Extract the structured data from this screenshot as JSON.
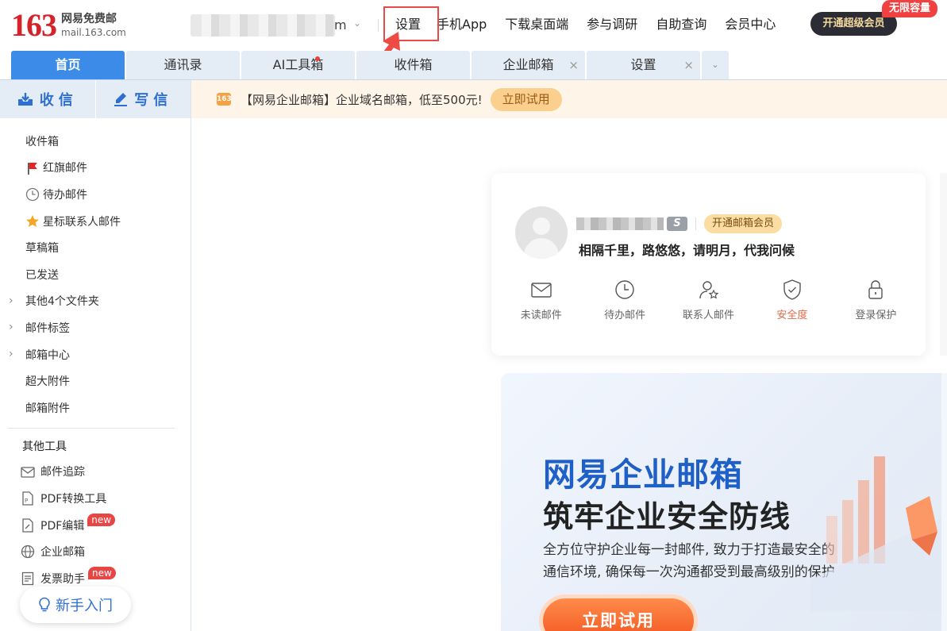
{
  "brand": {
    "number": "163",
    "name_cn": "网易免费邮",
    "domain": "mail.163.com"
  },
  "user": {
    "account_suffix": "m"
  },
  "top_nav": {
    "settings": "设置",
    "mobile_app": "手机App",
    "desktop": "下载桌面端",
    "survey": "参与调研",
    "self_service": "自助查询",
    "member_center": "会员中心",
    "super_vip": "开通超级会员",
    "vip_badge": "无限容量"
  },
  "tabs": [
    {
      "label": "首页"
    },
    {
      "label": "通讯录"
    },
    {
      "label": "AI工具箱"
    },
    {
      "label": "收件箱"
    },
    {
      "label": "企业邮箱"
    },
    {
      "label": "设置"
    }
  ],
  "tab_close": "×",
  "sidebar": {
    "receive": "收信",
    "compose": "写信",
    "folders": [
      "收件箱",
      "红旗邮件",
      "待办邮件",
      "星标联系人邮件",
      "草稿箱",
      "已发送",
      "其他4个文件夹",
      "邮件标签",
      "邮箱中心",
      "超大附件",
      "邮箱附件"
    ],
    "tools_title": "其他工具",
    "tools": [
      "邮件追踪",
      "PDF转换工具",
      "PDF编辑",
      "企业邮箱",
      "发票助手"
    ],
    "new_badge": "new",
    "beginner": "新手入门"
  },
  "promo": {
    "icon_text": "163",
    "text": "【网易企业邮箱】企业域名邮箱，低至500元!",
    "button": "立即试用"
  },
  "user_card": {
    "level_badge": "S",
    "member_badge": "开通邮箱会员",
    "greeting": "相隔千里，路悠悠，请明月，代我问候",
    "quick_items": [
      "未读邮件",
      "待办邮件",
      "联系人邮件",
      "安全度",
      "登录保护"
    ]
  },
  "enterprise": {
    "title1": "网易企业邮箱",
    "title2": "筑牢企业安全防线",
    "desc1": "全方位守护企业每一封邮件, 致力于打造最安全的",
    "desc2": "通信环境, 确保每一次沟通都受到最高级别的保护",
    "button": "立即试用"
  },
  "colors": {
    "brand_red": "#d4232a",
    "accent_blue": "#3c8be8",
    "highlight": "#e84a4a",
    "cta_orange": "#f2541e"
  }
}
